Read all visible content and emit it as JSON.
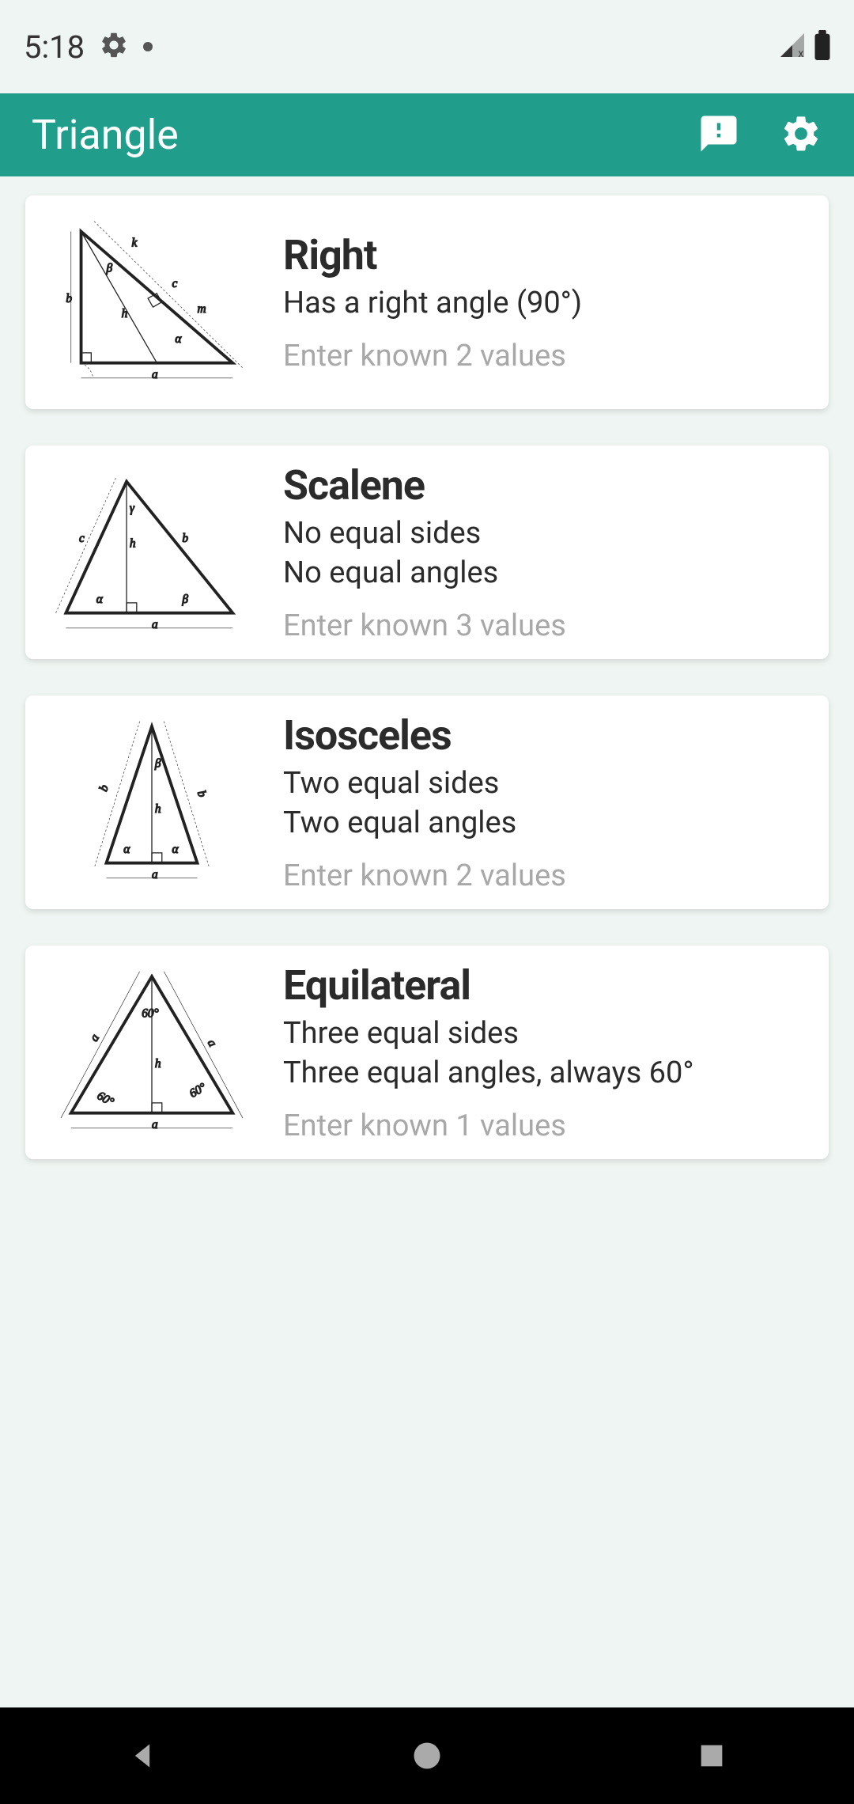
{
  "status": {
    "time": "5:18"
  },
  "app_bar": {
    "title": "Triangle"
  },
  "cards": [
    {
      "title": "Right",
      "desc_line1": "Has a right angle (90°)",
      "desc_line2": "",
      "hint": "Enter known 2 values"
    },
    {
      "title": "Scalene",
      "desc_line1": "No equal sides",
      "desc_line2": "No equal angles",
      "hint": "Enter known 3 values"
    },
    {
      "title": "Isosceles",
      "desc_line1": "Two equal sides",
      "desc_line2": "Two equal angles",
      "hint": "Enter known 2 values"
    },
    {
      "title": "Equilateral",
      "desc_line1": "Three equal sides",
      "desc_line2": "Three equal angles, always 60°",
      "hint": "Enter known 1 values"
    }
  ]
}
